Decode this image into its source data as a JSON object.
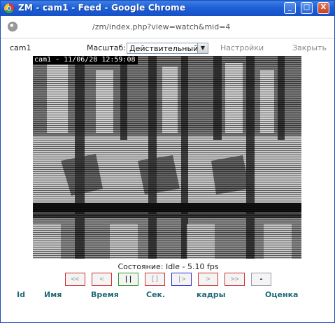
{
  "window": {
    "title": "ZM - cam1 - Feed - Google Chrome",
    "minimize": "_",
    "maximize": "□",
    "close": "X"
  },
  "address": {
    "url": "/zm/index.php?view=watch&mid=4"
  },
  "monitor": {
    "name": "cam1",
    "scale_label": "Масштаб:",
    "scale_value": "Действительный",
    "settings_link": "Настройки",
    "close_link": "Закрыть"
  },
  "video": {
    "timestamp": "cam1 - 11/06/28 12:59:08"
  },
  "status": {
    "text": "Состояние: Idle - 5.10 fps"
  },
  "controls": {
    "fast_rewind": "<<",
    "slow_rewind": "<",
    "pause": "||",
    "stop": "[]",
    "play": "|>",
    "slow_forward": ">",
    "fast_forward": ">>",
    "zoom_out": "-"
  },
  "events_table": {
    "headers": [
      "Id",
      "Имя",
      "Время",
      "Сек.",
      "кадры",
      "Оценка"
    ]
  },
  "colors": {
    "titlebar": "#1f5fd6",
    "header_text": "#1f6a78",
    "link_gray": "#888888"
  }
}
